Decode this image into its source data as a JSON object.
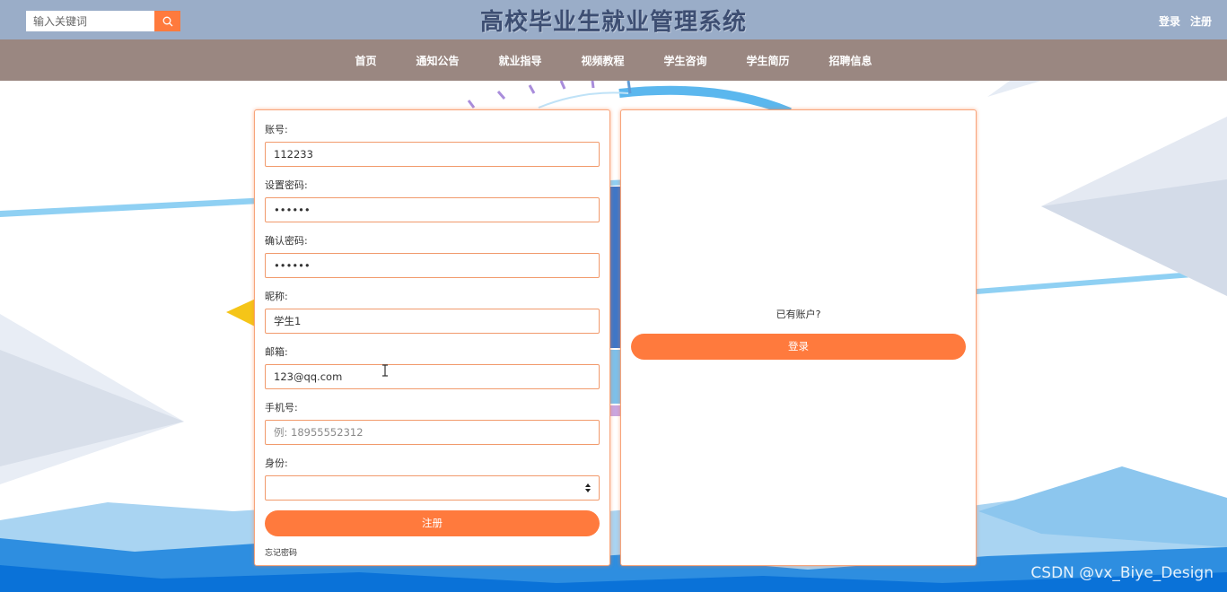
{
  "header": {
    "title": "高校毕业生就业管理系统",
    "search_placeholder": "输入关键词",
    "login_link": "登录",
    "register_link": "注册"
  },
  "nav": {
    "items": [
      "首页",
      "通知公告",
      "就业指导",
      "视频教程",
      "学生咨询",
      "学生简历",
      "招聘信息"
    ]
  },
  "register_form": {
    "account_label": "账号:",
    "account_value": "112233",
    "password_label": "设置密码:",
    "password_value": "••••••",
    "confirm_label": "确认密码:",
    "confirm_value": "••••••",
    "nickname_label": "昵称:",
    "nickname_value": "学生1",
    "email_label": "邮箱:",
    "email_value": "123@qq.com",
    "phone_label": "手机号:",
    "phone_placeholder": "例: 18955552312",
    "role_label": "身份:",
    "role_value": "",
    "submit_label": "注册",
    "forgot_label": "忘记密码"
  },
  "login_panel": {
    "prompt": "已有账户?",
    "login_label": "登录"
  },
  "watermark": "CSDN @vx_Biye_Design",
  "colors": {
    "topbar": "#9aadc8",
    "navbar": "#9a8781",
    "accent": "#ff7a3d",
    "title": "#3d4e72"
  },
  "icons": {
    "search_button": "search-icon",
    "select": "select-arrows-icon",
    "cursor": "text-cursor-icon"
  }
}
